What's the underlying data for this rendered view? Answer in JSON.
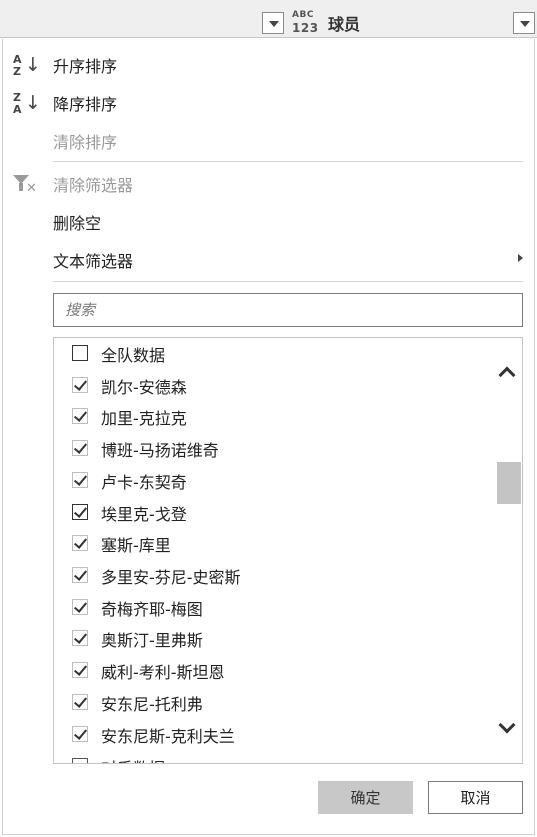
{
  "header": {
    "type_icon_top": "ABC",
    "type_icon_bottom": "123",
    "column_title": "球员"
  },
  "menu": {
    "sort_ascending": "升序排序",
    "sort_descending": "降序排序",
    "clear_sort": "清除排序",
    "clear_filter": "清除筛选器",
    "remove_empty": "删除空",
    "text_filters": "文本筛选器"
  },
  "sort_icons": {
    "az_top": "A",
    "az_bottom": "Z",
    "za_top": "Z",
    "za_bottom": "A",
    "arrow": "↓"
  },
  "search": {
    "placeholder": "搜索",
    "value": ""
  },
  "list": {
    "items": [
      {
        "label": "全队数据",
        "checked": false
      },
      {
        "label": "凯尔-安德森",
        "checked": true
      },
      {
        "label": "加里-克拉克",
        "checked": true
      },
      {
        "label": "博班-马扬诺维奇",
        "checked": true
      },
      {
        "label": "卢卡-东契奇",
        "checked": true
      },
      {
        "label": "埃里克-戈登",
        "checked": true
      },
      {
        "label": "塞斯-库里",
        "checked": true
      },
      {
        "label": "多里安-芬尼-史密斯",
        "checked": true
      },
      {
        "label": "奇梅齐耶-梅图",
        "checked": true
      },
      {
        "label": "奥斯汀-里弗斯",
        "checked": true
      },
      {
        "label": "威利-考利-斯坦恩",
        "checked": true
      },
      {
        "label": "安东尼-托利弗",
        "checked": true
      },
      {
        "label": "安东尼斯-克利夫兰",
        "checked": true
      },
      {
        "label": "对手数据",
        "checked": false
      }
    ]
  },
  "buttons": {
    "ok": "确定",
    "cancel": "取消"
  }
}
